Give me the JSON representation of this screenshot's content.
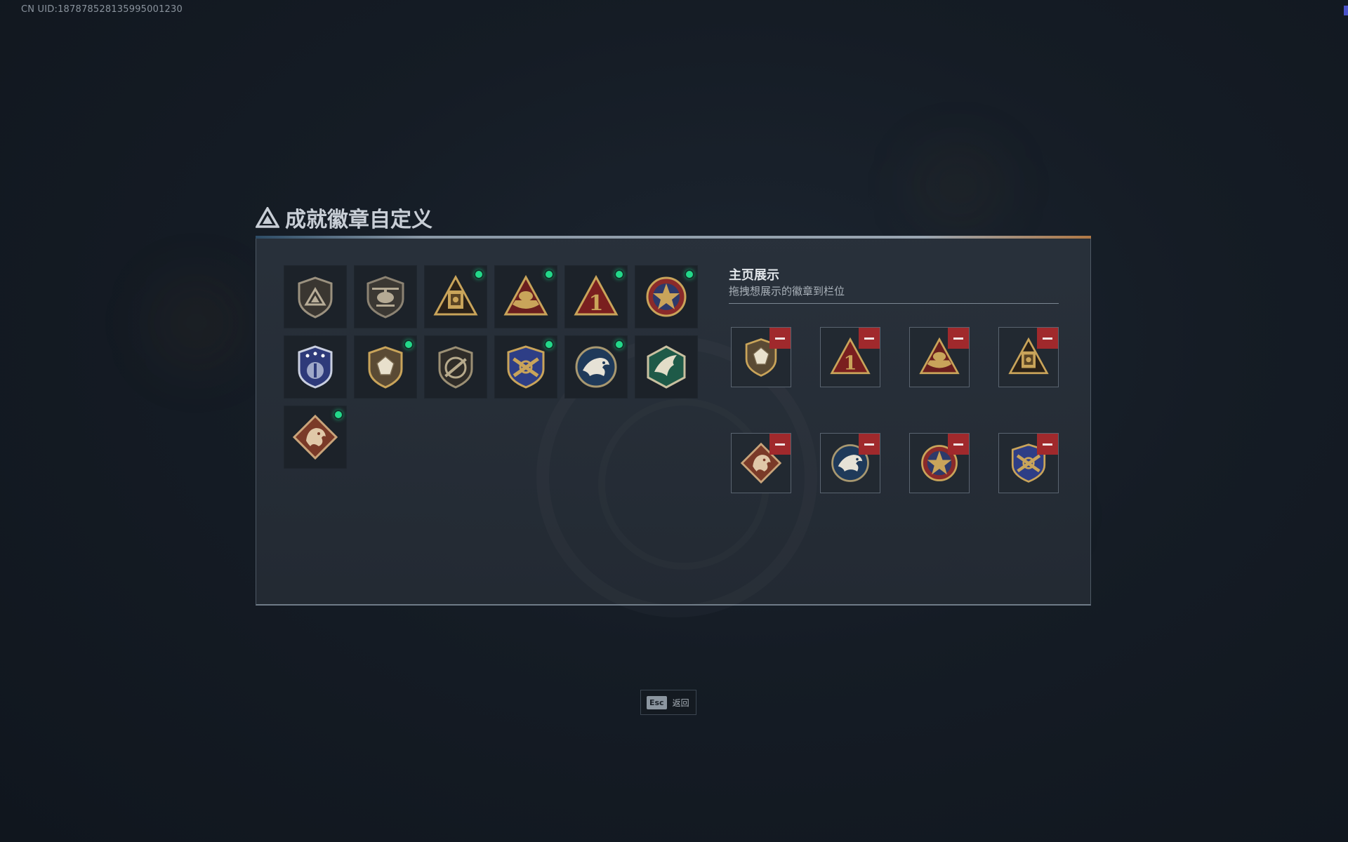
{
  "uid_text": "CN UID:187878528135995001230",
  "dialog": {
    "title": "成就徽章自定义"
  },
  "badges": [
    {
      "icon": "triangle-shield-badge-icon",
      "new": false
    },
    {
      "icon": "helicopter-badge-icon",
      "new": false
    },
    {
      "icon": "vault-triangle-badge-icon",
      "new": true
    },
    {
      "icon": "cargo-triangle-badge-icon",
      "new": true
    },
    {
      "icon": "number-one-triangle-badge-icon",
      "new": true
    },
    {
      "icon": "star-medal-badge-icon",
      "new": true
    },
    {
      "icon": "police-shield-badge-icon",
      "new": false
    },
    {
      "icon": "gem-shield-badge-icon",
      "new": true
    },
    {
      "icon": "rifle-shield-badge-icon",
      "new": false
    },
    {
      "icon": "crossed-weapons-badge-icon",
      "new": true
    },
    {
      "icon": "eagle-badge-icon",
      "new": true
    },
    {
      "icon": "hawk-hexagon-badge-icon",
      "new": false
    },
    {
      "icon": "dragon-badge-icon",
      "new": true
    }
  ],
  "showcase": {
    "title": "主页展示",
    "subtitle": "拖拽想展示的徽章到栏位",
    "slots": [
      {
        "icon": "gem-shield-badge-icon"
      },
      {
        "icon": "number-one-triangle-badge-icon"
      },
      {
        "icon": "cargo-triangle-badge-icon"
      },
      {
        "icon": "vault-triangle-badge-icon"
      },
      {
        "icon": "dragon-badge-icon"
      },
      {
        "icon": "eagle-badge-icon"
      },
      {
        "icon": "star-medal-badge-icon"
      },
      {
        "icon": "crossed-weapons-badge-icon"
      }
    ]
  },
  "footer": {
    "esc_key": "Esc",
    "back_label": "返回"
  },
  "colors": {
    "new_dot": "#23d98a",
    "remove_button": "#a0292c",
    "gold": "#c9a45a"
  }
}
